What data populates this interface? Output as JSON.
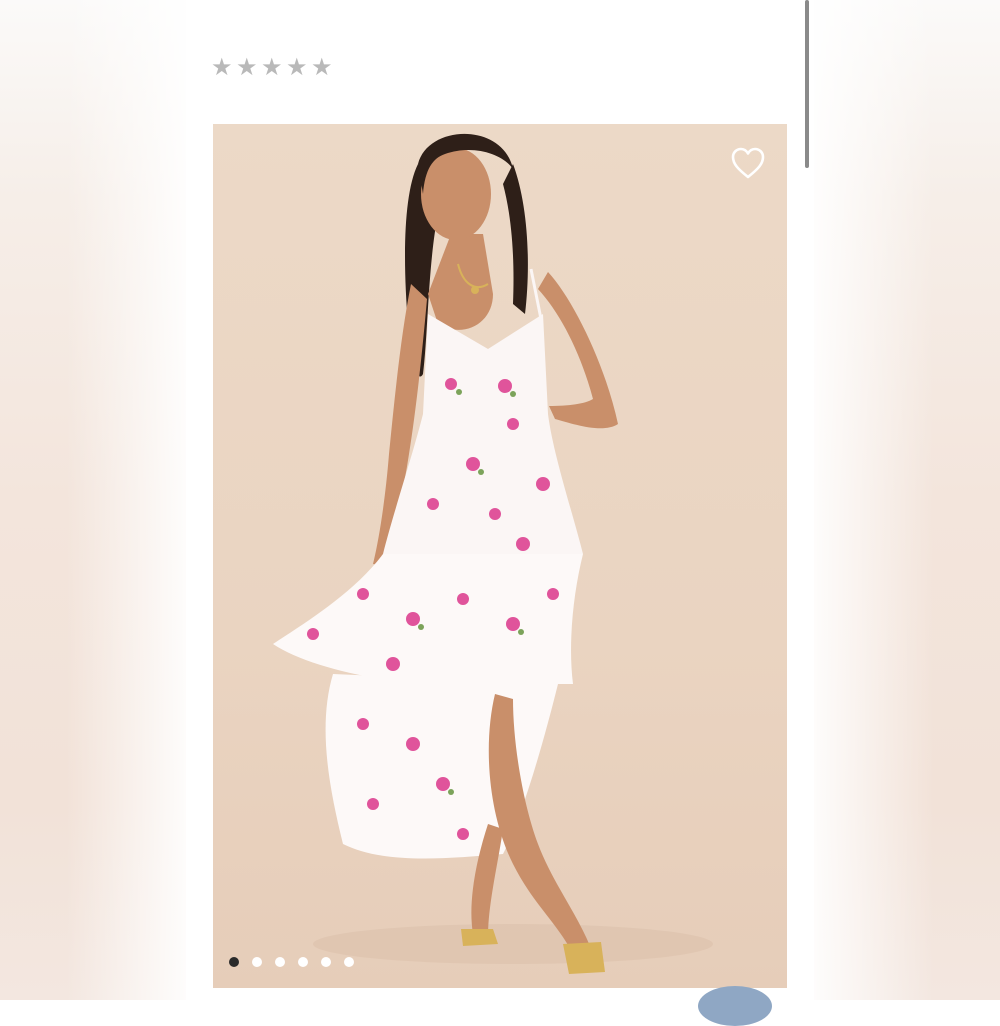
{
  "rating": {
    "stars": 5,
    "filled": 0,
    "icon": "star-icon"
  },
  "product_image": {
    "subject": "model-in-floral-tiered-maxi-dress",
    "favorite_icon": "heart-outline-icon",
    "carousel": {
      "total": 6,
      "active_index": 0
    }
  },
  "colors": {
    "backdrop": "#ead4c1",
    "star": "#b9b9b9",
    "dot_active": "#2a2a2a",
    "dot_inactive": "#ffffff",
    "badge": "#8fa7c4"
  }
}
